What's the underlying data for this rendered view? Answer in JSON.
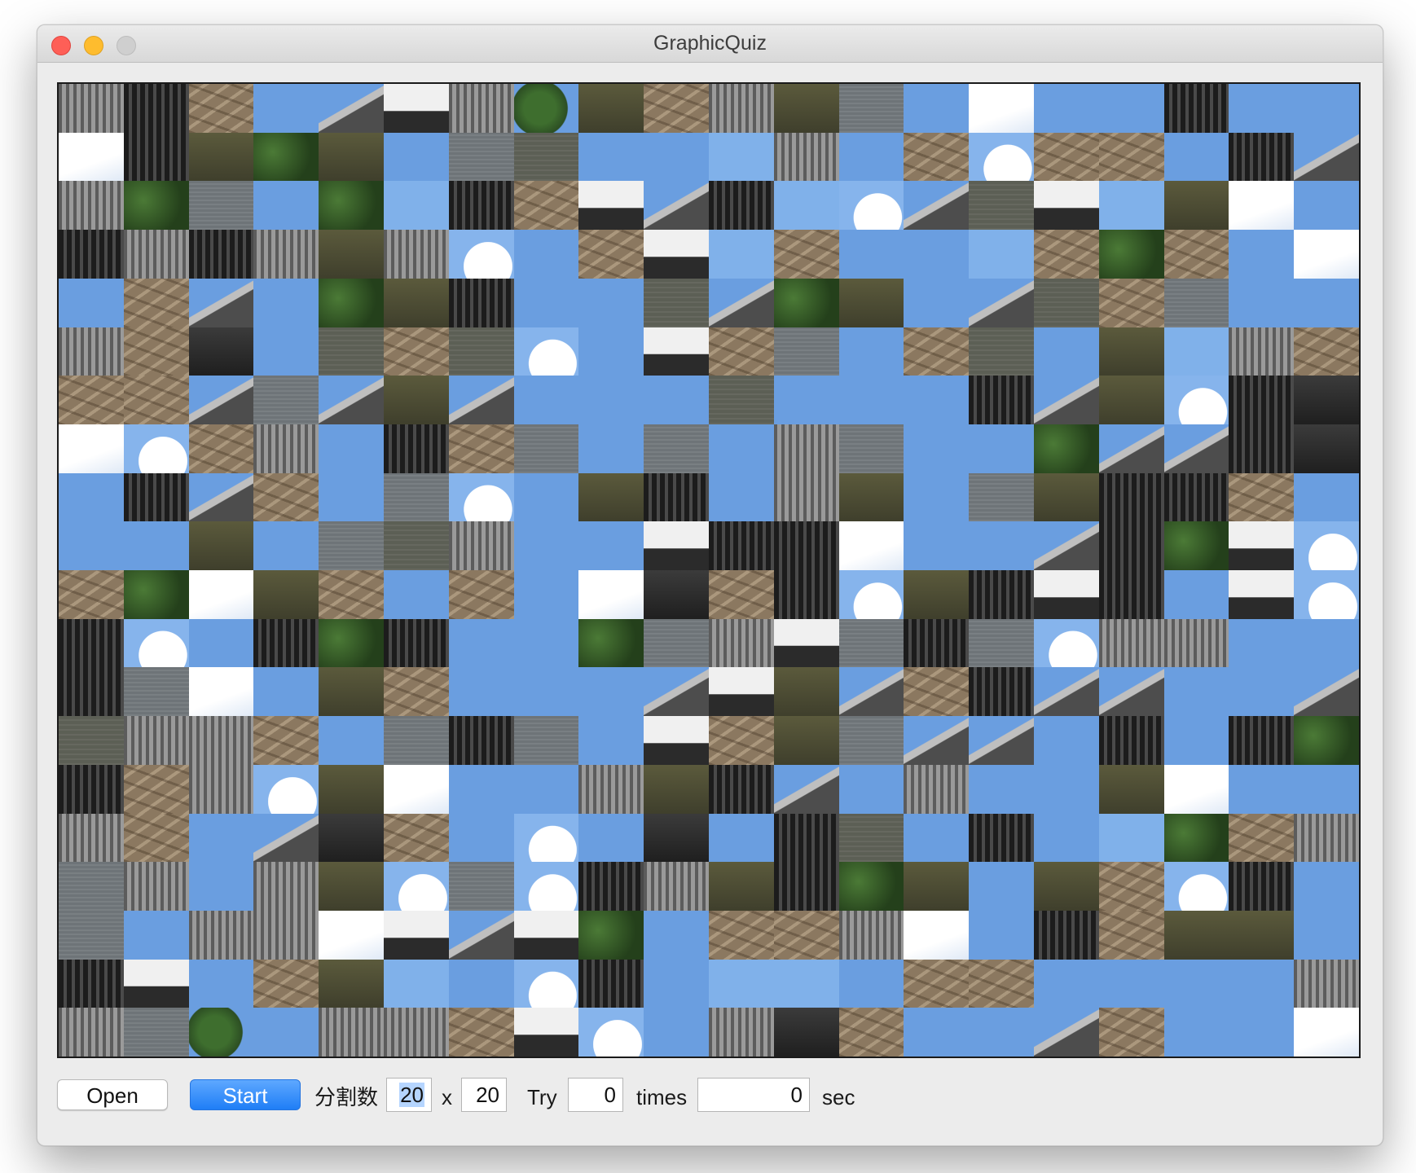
{
  "window": {
    "title": "GraphicQuiz"
  },
  "board": {
    "rows": 20,
    "cols": 20,
    "tiles": [
      "roof",
      "darkwin",
      "wall",
      "sky",
      "roofsky",
      "white",
      "roof",
      "tree",
      "olive",
      "wall",
      "roof",
      "olive",
      "water2",
      "sky",
      "cloudfull",
      "sky",
      "sky",
      "darkwin",
      "sky",
      "sky",
      "cloudfull",
      "darkwin",
      "olive",
      "trees",
      "olive",
      "sky",
      "water2",
      "water",
      "sky",
      "sky",
      "sky2",
      "roof",
      "sky",
      "wall",
      "cloud",
      "wall",
      "wall",
      "sky",
      "darkwin",
      "roofsky",
      "roof",
      "trees",
      "water2",
      "sky",
      "trees",
      "sky2",
      "darkwin",
      "wall",
      "white",
      "roofsky",
      "darkwin",
      "sky2",
      "cloud",
      "roofsky",
      "water",
      "white",
      "sky2",
      "olive",
      "cloudfull",
      "sky",
      "darkwin",
      "roof",
      "darkwin",
      "roof",
      "olive",
      "roof",
      "cloud",
      "sky",
      "wall",
      "white",
      "sky2",
      "wall",
      "sky",
      "sky",
      "sky2",
      "wall",
      "trees",
      "wall",
      "sky",
      "cloudfull",
      "sky",
      "wall",
      "roofsky",
      "sky",
      "trees",
      "olive",
      "darkwin",
      "sky",
      "sky",
      "water",
      "roofsky",
      "trees",
      "olive",
      "sky",
      "roofsky",
      "water",
      "wall",
      "water2",
      "sky",
      "sky",
      "roof",
      "wall",
      "dark",
      "sky",
      "water",
      "wall",
      "water",
      "cloud",
      "sky",
      "white",
      "wall",
      "water2",
      "sky",
      "wall",
      "water",
      "sky",
      "olive",
      "sky2",
      "roof",
      "wall",
      "wall",
      "wall",
      "roofsky",
      "water2",
      "roofsky",
      "olive",
      "roofsky",
      "sky",
      "sky",
      "sky",
      "water",
      "sky",
      "sky",
      "sky",
      "darkwin",
      "roofsky",
      "olive",
      "cloud",
      "darkwin",
      "dark",
      "cloudfull",
      "cloud",
      "wall",
      "roof",
      "sky",
      "darkwin",
      "wall",
      "water2",
      "sky",
      "water2",
      "sky",
      "roof",
      "water2",
      "sky",
      "sky",
      "trees",
      "roofsky",
      "roofsky",
      "darkwin",
      "dark",
      "sky",
      "darkwin",
      "roofsky",
      "wall",
      "sky",
      "water2",
      "cloud",
      "sky",
      "olive",
      "darkwin",
      "sky",
      "roof",
      "olive",
      "sky",
      "water2",
      "olive",
      "darkwin",
      "darkwin",
      "wall",
      "sky",
      "sky",
      "sky",
      "olive",
      "sky",
      "water2",
      "water",
      "roof",
      "sky",
      "sky",
      "white",
      "darkwin",
      "darkwin",
      "cloudfull",
      "sky",
      "sky",
      "roofsky",
      "darkwin",
      "trees",
      "white",
      "cloud",
      "wall",
      "trees",
      "cloudfull",
      "olive",
      "wall",
      "sky",
      "wall",
      "sky",
      "cloudfull",
      "dark",
      "wall",
      "darkwin",
      "cloud",
      "olive",
      "darkwin",
      "white",
      "darkwin",
      "sky",
      "white",
      "cloud",
      "darkwin",
      "cloud",
      "sky",
      "darkwin",
      "trees",
      "darkwin",
      "sky",
      "sky",
      "trees",
      "water2",
      "roof",
      "white",
      "water2",
      "darkwin",
      "water2",
      "cloud",
      "roof",
      "roof",
      "sky",
      "sky",
      "darkwin",
      "water2",
      "cloudfull",
      "sky",
      "olive",
      "wall",
      "sky",
      "sky",
      "sky",
      "roofsky",
      "white",
      "olive",
      "roofsky",
      "wall",
      "darkwin",
      "roofsky",
      "roofsky",
      "sky",
      "sky",
      "roofsky",
      "water",
      "roof",
      "roof",
      "wall",
      "sky",
      "water2",
      "darkwin",
      "water2",
      "sky",
      "white",
      "wall",
      "olive",
      "water2",
      "roofsky",
      "roofsky",
      "sky",
      "darkwin",
      "sky",
      "darkwin",
      "trees",
      "darkwin",
      "wall",
      "roof",
      "cloud",
      "olive",
      "cloudfull",
      "sky",
      "sky",
      "roof",
      "olive",
      "darkwin",
      "roofsky",
      "sky",
      "roof",
      "sky",
      "sky",
      "olive",
      "cloudfull",
      "sky",
      "sky",
      "roof",
      "wall",
      "sky",
      "roofsky",
      "dark",
      "wall",
      "sky",
      "cloud",
      "sky",
      "dark",
      "sky",
      "darkwin",
      "water",
      "sky",
      "darkwin",
      "sky",
      "sky2",
      "trees",
      "wall",
      "roof",
      "water2",
      "roof",
      "sky",
      "roof",
      "olive",
      "cloud",
      "water2",
      "cloud",
      "darkwin",
      "roof",
      "olive",
      "darkwin",
      "trees",
      "olive",
      "sky",
      "olive",
      "wall",
      "cloud",
      "darkwin",
      "sky",
      "water2",
      "sky",
      "roof",
      "roof",
      "cloudfull",
      "white",
      "roofsky",
      "white",
      "trees",
      "sky",
      "wall",
      "wall",
      "roof",
      "cloudfull",
      "sky",
      "darkwin",
      "wall",
      "olive",
      "olive",
      "sky",
      "darkwin",
      "white",
      "sky",
      "wall",
      "olive",
      "sky2",
      "sky",
      "cloud",
      "darkwin",
      "sky",
      "sky2",
      "sky2",
      "sky",
      "wall",
      "wall",
      "sky",
      "sky",
      "sky",
      "sky",
      "roof",
      "roof",
      "water2",
      "tree",
      "sky",
      "roof",
      "roof",
      "wall",
      "white",
      "cloud",
      "sky",
      "roof",
      "dark",
      "wall",
      "sky",
      "sky",
      "roofsky",
      "wall",
      "sky",
      "sky",
      "cloudfull"
    ]
  },
  "controls": {
    "open_label": "Open",
    "start_label": "Start",
    "division_label": "分割数",
    "rows_value": "20",
    "times_sep": "x",
    "cols_value": "20",
    "try_label": "Try",
    "try_value": "0",
    "times_label": "times",
    "seconds_value": "0",
    "sec_label": "sec"
  }
}
